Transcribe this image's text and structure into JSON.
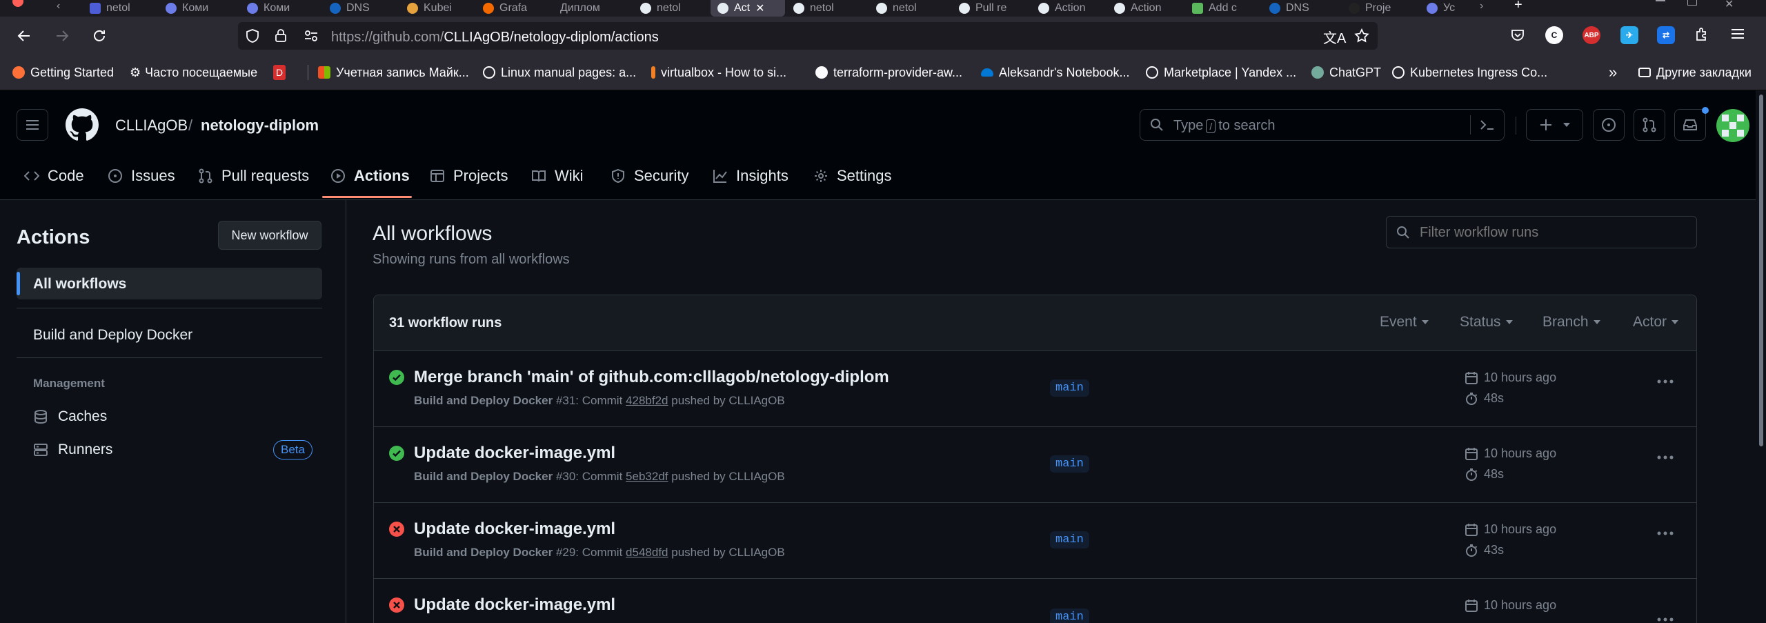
{
  "browser": {
    "tabs": [
      "netol",
      "Кoми",
      "Кoми",
      "DNS",
      "Kubei",
      "Grafa",
      "Диплом",
      "netol",
      "Act",
      "netol",
      "netol",
      "Pull re",
      "Action",
      "Action",
      "Add c",
      "DNS",
      "Proje",
      "Ус"
    ],
    "url_host": "https://github.com/",
    "url_path": "CLLIAgOB/netology-diplom/actions",
    "extensions": [
      "C",
      "ABP"
    ],
    "bookmarks": [
      "Getting Started",
      "Часто посещаемые",
      "Учетная запись Майк...",
      "Linux manual pages: a...",
      "virtualbox - How to si...",
      "terraform-provider-aw...",
      "Aleksandr's Notebook...",
      "Marketplace | Yandex ...",
      "ChatGPT",
      "Kubernetes Ingress Co..."
    ],
    "other_bookmarks": "Другие закладки"
  },
  "header": {
    "owner": "CLLIAgOB",
    "separator": "/",
    "repo": "netology-diplom",
    "search_before": "Type",
    "search_key": "/",
    "search_after": "to search"
  },
  "repo_nav": [
    {
      "label": "Code",
      "icon": "code-icon"
    },
    {
      "label": "Issues",
      "icon": "issue-opened-icon"
    },
    {
      "label": "Pull requests",
      "icon": "git-pull-request-icon"
    },
    {
      "label": "Actions",
      "icon": "play-icon"
    },
    {
      "label": "Projects",
      "icon": "table-icon"
    },
    {
      "label": "Wiki",
      "icon": "book-icon"
    },
    {
      "label": "Security",
      "icon": "shield-icon"
    },
    {
      "label": "Insights",
      "icon": "graph-icon"
    },
    {
      "label": "Settings",
      "icon": "gear-icon"
    }
  ],
  "sidebar": {
    "title": "Actions",
    "new_workflow": "New workflow",
    "items": [
      "All workflows",
      "Build and Deploy Docker"
    ],
    "management_heading": "Management",
    "caches": "Caches",
    "runners": "Runners",
    "beta_badge": "Beta"
  },
  "main": {
    "title": "All workflows",
    "subtitle": "Showing runs from all workflows",
    "filter_placeholder": "Filter workflow runs",
    "runs_count": "31 workflow runs",
    "filters": [
      "Event",
      "Status",
      "Branch",
      "Actor"
    ],
    "runs": [
      {
        "status": "success",
        "title": "Merge branch 'main' of github.com:clllagob/netology-diplom",
        "workflow": "Build and Deploy Docker",
        "run": "#31: Commit",
        "commit": "428bf2d",
        "pushed_by": "pushed by CLLIAgOB",
        "branch": "main",
        "time": "10 hours ago",
        "duration": "48s"
      },
      {
        "status": "success",
        "title": "Update docker-image.yml",
        "workflow": "Build and Deploy Docker",
        "run": "#30: Commit",
        "commit": "5eb32df",
        "pushed_by": "pushed by CLLIAgOB",
        "branch": "main",
        "time": "10 hours ago",
        "duration": "48s"
      },
      {
        "status": "failure",
        "title": "Update docker-image.yml",
        "workflow": "Build and Deploy Docker",
        "run": "#29: Commit",
        "commit": "d548dfd",
        "pushed_by": "pushed by CLLIAgOB",
        "branch": "main",
        "time": "10 hours ago",
        "duration": "43s"
      },
      {
        "status": "failure",
        "title": "Update docker-image.yml",
        "workflow": "",
        "run": "",
        "commit": "",
        "pushed_by": "",
        "branch": "main",
        "time": "10 hours ago",
        "duration": ""
      }
    ]
  },
  "colors": {
    "success": "#3fb950",
    "failure": "#f85149",
    "accent": "#fd8c73",
    "link": "#4493f8"
  }
}
